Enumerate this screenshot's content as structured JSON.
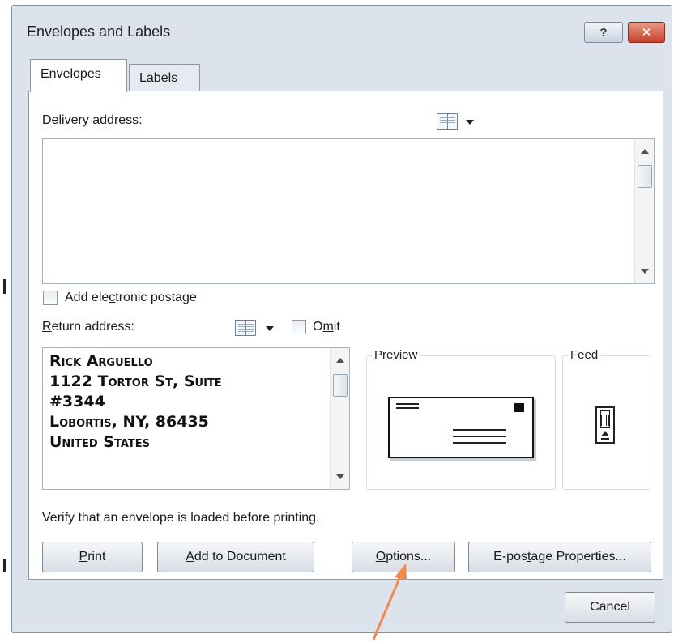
{
  "dialog": {
    "title": "Envelopes and Labels",
    "help_icon_glyph": "?",
    "close_icon_glyph": "✕"
  },
  "tabs": [
    {
      "label": "Envelopes",
      "accel": "E",
      "rest": "nvelopes",
      "selected": true
    },
    {
      "label": "Labels",
      "accel": "L",
      "rest": "abels",
      "selected": false
    }
  ],
  "delivery": {
    "label": "Delivery address:",
    "accel": "D",
    "rest": "elivery address:",
    "value": "",
    "book_icon": "address-book-icon"
  },
  "electronic_postage": {
    "label": "Add electronic postage",
    "pre": "Add ele",
    "accel": "c",
    "post": "tronic postage",
    "checked": false
  },
  "return": {
    "label": "Return address:",
    "accel": "R",
    "rest": "eturn address:",
    "omit_label": "Omit",
    "omit_pre": "O",
    "omit_accel": "m",
    "omit_post": "it",
    "omit_checked": false,
    "lines": [
      "Rick Arguello",
      "1122 Tortor St, Suite",
      "#3344",
      "Lobortis, NY, 86435",
      "United States"
    ]
  },
  "preview": {
    "label": "Preview"
  },
  "feed": {
    "label": "Feed"
  },
  "note": "Verify that an envelope is loaded before printing.",
  "buttons": {
    "print": {
      "label": "Print",
      "accel": "P",
      "rest": "rint"
    },
    "add_to_document": {
      "label": "Add to Document",
      "accel": "A",
      "rest": "dd to Document"
    },
    "options": {
      "label": "Options...",
      "accel": "O",
      "rest": "ptions..."
    },
    "epostage": {
      "label": "E-postage Properties...",
      "pre": "E-pos",
      "accel": "t",
      "post": "age Properties..."
    },
    "cancel": {
      "label": "Cancel"
    }
  },
  "colors": {
    "dialog_bg": "#dde3ec",
    "close_button": "#c4412b",
    "annotation_arrow": "#f08a4b"
  }
}
